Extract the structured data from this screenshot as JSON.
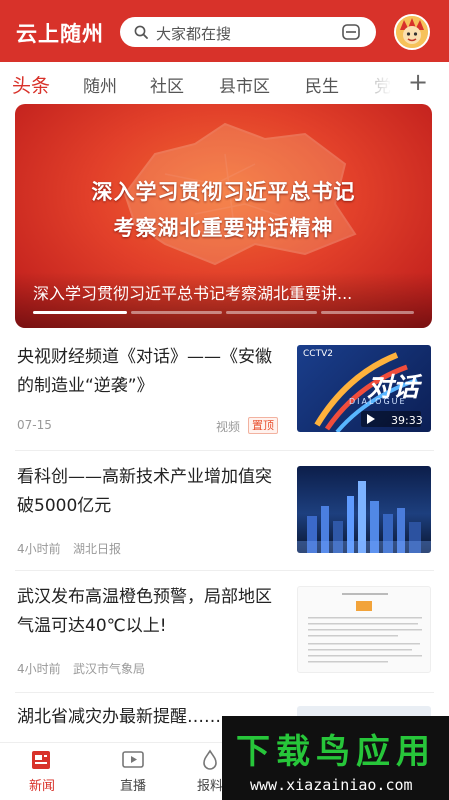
{
  "header": {
    "logo": "云上随州",
    "search_placeholder": "大家都在搜",
    "colors": {
      "brand": "#d8322a",
      "accent": "#e8502f"
    }
  },
  "tabs": [
    {
      "label": "头条",
      "active": true
    },
    {
      "label": "随州"
    },
    {
      "label": "社区"
    },
    {
      "label": "县市区"
    },
    {
      "label": "民生"
    },
    {
      "label": "党"
    }
  ],
  "tab_add_label": "+",
  "banner": {
    "headline_line1": "深入学习贯彻习近平总书记",
    "headline_line2": "考察湖北重要讲话精神",
    "caption": "深入学习贯彻习近平总书记考察湖北重要讲...",
    "slide_count": 4,
    "active_slide": 1
  },
  "news": [
    {
      "title": "央视财经频道《对话》——《安徽的制造业“逆袭”》",
      "date": "07-15",
      "tag": "视频",
      "badge": "置顶",
      "thumb": {
        "channel": "CCTV2",
        "brand_text": "对话",
        "sub_text": "DIALOGUE",
        "duration": "39:33"
      }
    },
    {
      "title": "看科创——高新技术产业增加值突破5000亿元",
      "time": "4小时前",
      "source": "湖北日报"
    },
    {
      "title": "武汉发布高温橙色预警，局部地区气温可达40℃以上!",
      "time": "4小时前",
      "source": "武汉市气象局"
    },
    {
      "title": "湖北省减灾办最新提醒……"
    }
  ],
  "bottom_nav": [
    {
      "label": "新闻",
      "icon": "news-icon",
      "active": true
    },
    {
      "label": "直播",
      "icon": "live-icon"
    },
    {
      "label": "报料",
      "icon": "report-icon"
    }
  ],
  "watermark": {
    "main": "下载鸟应用",
    "url": "www.xiazainiao.com"
  }
}
